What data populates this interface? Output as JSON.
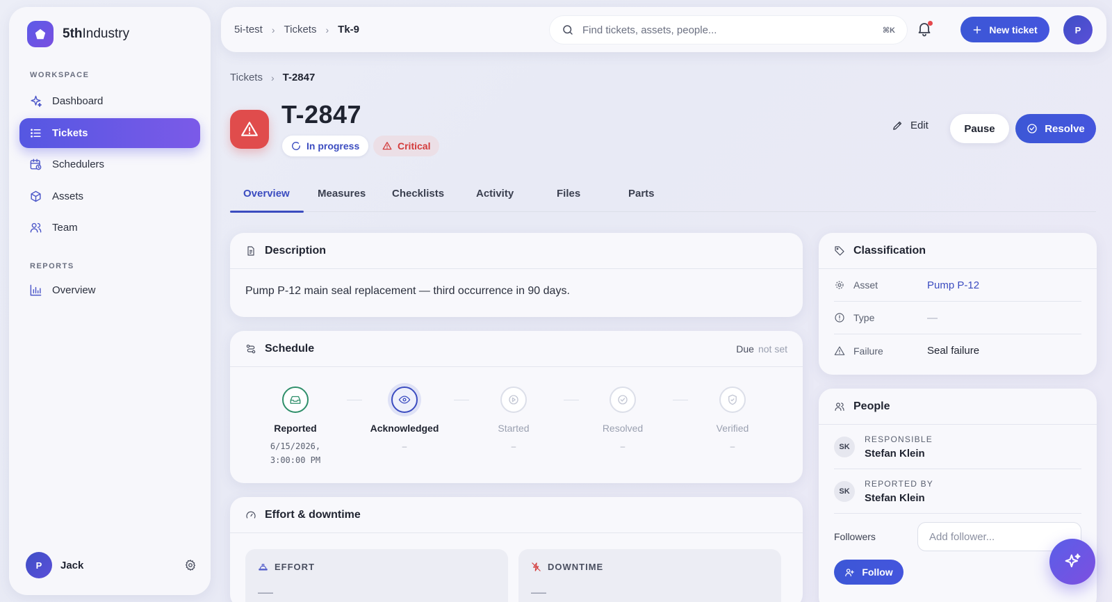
{
  "brand": {
    "name_bold": "5th",
    "name_rest": "Industry"
  },
  "sidebar": {
    "workspace_label": "WORKSPACE",
    "reports_label": "REPORTS",
    "items": [
      {
        "label": "Dashboard",
        "icon": "sparkle-icon"
      },
      {
        "label": "Tickets",
        "icon": "list-icon",
        "active": true
      },
      {
        "label": "Schedulers",
        "icon": "calendar-clock-icon"
      },
      {
        "label": "Assets",
        "icon": "cube-icon"
      },
      {
        "label": "Team",
        "icon": "users-icon"
      }
    ],
    "reports_items": [
      {
        "label": "Overview",
        "icon": "bar-chart-icon"
      }
    ],
    "user": {
      "initial": "P",
      "name": "Jack"
    }
  },
  "topbar": {
    "crumbs": [
      "5i-test",
      "Tickets",
      "Tk-9"
    ],
    "search_placeholder": "Find tickets, assets, people...",
    "search_shortcut": "⌘K",
    "new_ticket_label": "New ticket",
    "avatar_initial": "P"
  },
  "page": {
    "crumbs": [
      "Tickets",
      "T-2847"
    ],
    "title": "T-2847",
    "status": "In progress",
    "priority": "Critical",
    "edit_label": "Edit",
    "pause_label": "Pause",
    "resolve_label": "Resolve"
  },
  "tabs": [
    "Overview",
    "Measures",
    "Checklists",
    "Activity",
    "Files",
    "Parts"
  ],
  "description": {
    "title": "Description",
    "text": "Pump P-12 main seal replacement — third occurrence in 90 days."
  },
  "schedule": {
    "title": "Schedule",
    "due_label": "Due",
    "due_value": "not set",
    "steps": [
      {
        "name": "Reported",
        "line1": "6/15/2026,",
        "line2": "3:00:00 PM",
        "state": "done"
      },
      {
        "name": "Acknowledged",
        "line1": "–",
        "line2": "",
        "state": "current"
      },
      {
        "name": "Started",
        "line1": "–",
        "line2": "",
        "state": "pending"
      },
      {
        "name": "Resolved",
        "line1": "–",
        "line2": "",
        "state": "pending"
      },
      {
        "name": "Verified",
        "line1": "–",
        "line2": "",
        "state": "pending"
      }
    ]
  },
  "effort": {
    "title": "Effort & downtime",
    "effort_label": "EFFORT",
    "effort_value": "—",
    "downtime_label": "DOWNTIME",
    "downtime_value": "—"
  },
  "classification": {
    "title": "Classification",
    "rows": [
      {
        "key": "Asset",
        "value": "Pump P-12"
      },
      {
        "key": "Type",
        "value": "—"
      },
      {
        "key": "Failure",
        "value": "Seal failure"
      }
    ]
  },
  "people": {
    "title": "People",
    "responsible_label": "RESPONSIBLE",
    "responsible_initials": "SK",
    "responsible_name": "Stefan Klein",
    "reported_label": "REPORTED BY",
    "reported_initials": "SK",
    "reported_name": "Stefan Klein",
    "followers_label": "Followers",
    "follower_placeholder": "Add follower...",
    "follow_label": "Follow"
  },
  "colors": {
    "accent": "#3b4cc0",
    "critical": "#e04c4c",
    "success": "#2f8f6a"
  }
}
